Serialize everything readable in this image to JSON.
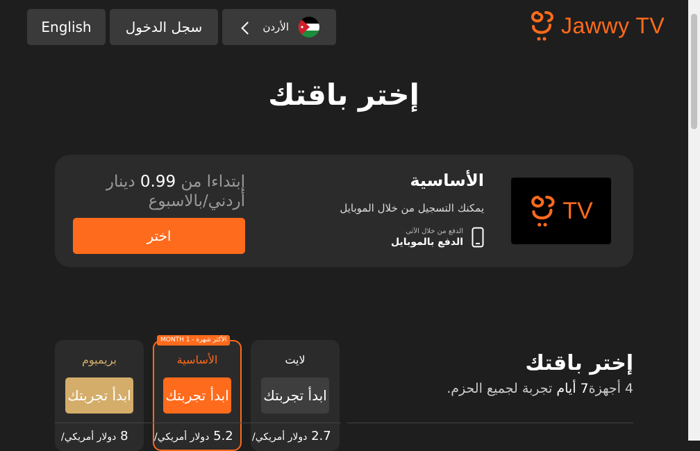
{
  "header": {
    "english_label": "English",
    "login_label": "سجل الدخول",
    "country_label": "الأردن",
    "brand": "Jawwy TV"
  },
  "page_title": "إختر باقتك",
  "featured_plan": {
    "name": "الأساسية",
    "subtitle": "يمكنك التسجيل من خلال الموبايل",
    "payment_small": "الدفع من خلال الآتى",
    "payment_label": "الدفع بالموبايل",
    "tv_label": "TV",
    "price_text_1": "إبتداءا من",
    "price_value": "0.99",
    "price_text_2": "دينار",
    "price_text_3": "أردني/بالاسبوع",
    "choose_label": "اختر"
  },
  "compare": {
    "title": "إختر باقتك",
    "subtitle_pre": "4 أجهزة",
    "subtitle_num": "7",
    "subtitle_days": "أيام",
    "subtitle_post": "تجربة لجميع الحزم.",
    "popular_badge": "MONTH 1 - الأكثر شهرة",
    "plans": [
      {
        "name": "بريميوم",
        "button": "ابدأ تجربتك",
        "price": "8",
        "unit": "دولار أمريكي/"
      },
      {
        "name": "الأساسية",
        "button": "ابدأ تجربتك",
        "price": "5.2",
        "unit": "دولار أمريكي/"
      },
      {
        "name": "لايت",
        "button": "ابدأ تجربتك",
        "price": "2.7",
        "unit": "دولار أمريكي/"
      }
    ]
  },
  "colors": {
    "accent": "#ff6b1c",
    "premium": "#d4ad6a",
    "bg": "#1e1e1e",
    "card": "#2b2b2b"
  }
}
